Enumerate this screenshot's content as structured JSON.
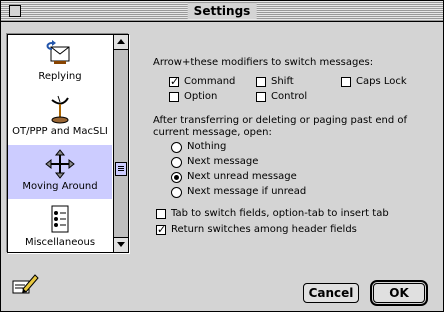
{
  "window": {
    "title": "Settings"
  },
  "sidebar": {
    "items": [
      {
        "label": "Replying",
        "icon": "reply-icon"
      },
      {
        "label": "OT/PPP and MacSLI",
        "icon": "satellite-dish-icon"
      },
      {
        "label": "Moving Around",
        "icon": "arrows-move-icon",
        "selected": true
      },
      {
        "label": "Miscellaneous",
        "icon": "checklist-icon"
      }
    ]
  },
  "section1": {
    "heading": "Arrow+these modifiers to switch messages:",
    "checkboxes": [
      {
        "label": "Command",
        "checked": true
      },
      {
        "label": "Shift",
        "checked": false
      },
      {
        "label": "Caps Lock",
        "checked": false
      },
      {
        "label": "Option",
        "checked": false
      },
      {
        "label": "Control",
        "checked": false
      }
    ]
  },
  "section2": {
    "heading_line1": "After transferring or deleting or paging past end of",
    "heading_line2": "current message, open:",
    "radios": [
      {
        "label": "Nothing",
        "selected": false
      },
      {
        "label": "Next message",
        "selected": false
      },
      {
        "label": "Next unread message",
        "selected": true
      },
      {
        "label": "Next message if unread",
        "selected": false
      }
    ]
  },
  "section3": {
    "checkboxes": [
      {
        "label": "Tab to switch fields, option-tab to insert tab",
        "checked": false
      },
      {
        "label": "Return switches among header fields",
        "checked": true
      }
    ]
  },
  "buttons": {
    "cancel": "Cancel",
    "ok": "OK"
  },
  "colors": {
    "selection": "#ccccff",
    "window_bg": "#d4d4d4"
  }
}
